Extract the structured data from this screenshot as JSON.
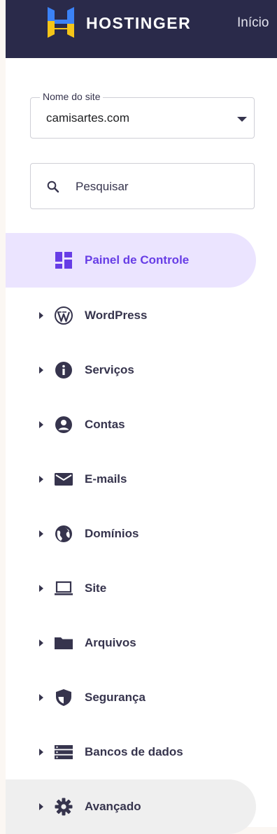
{
  "header": {
    "brand": "HOSTINGER",
    "nav_link": "Início",
    "colors": {
      "bar": "#2a2a4a",
      "logo_blue": "#3b82f6",
      "logo_yellow": "#f5c518"
    }
  },
  "site_selector": {
    "label": "Nome do site",
    "value": "camisartes.com"
  },
  "search": {
    "placeholder": "Pesquisar"
  },
  "menu": {
    "colors": {
      "active_bg": "#ebe4ff",
      "active_text": "#673de6",
      "text": "#36344d"
    },
    "items": [
      {
        "label": "Painel de Controle",
        "icon": "dashboard-icon",
        "state": "active"
      },
      {
        "label": "WordPress",
        "icon": "wordpress-icon"
      },
      {
        "label": "Serviços",
        "icon": "info-icon"
      },
      {
        "label": "Contas",
        "icon": "account-icon"
      },
      {
        "label": "E-mails",
        "icon": "mail-icon"
      },
      {
        "label": "Domínios",
        "icon": "globe-icon"
      },
      {
        "label": "Site",
        "icon": "laptop-icon"
      },
      {
        "label": "Arquivos",
        "icon": "folder-icon"
      },
      {
        "label": "Segurança",
        "icon": "shield-icon"
      },
      {
        "label": "Bancos de dados",
        "icon": "database-icon"
      },
      {
        "label": "Avançado",
        "icon": "gear-icon",
        "state": "hover"
      }
    ]
  }
}
